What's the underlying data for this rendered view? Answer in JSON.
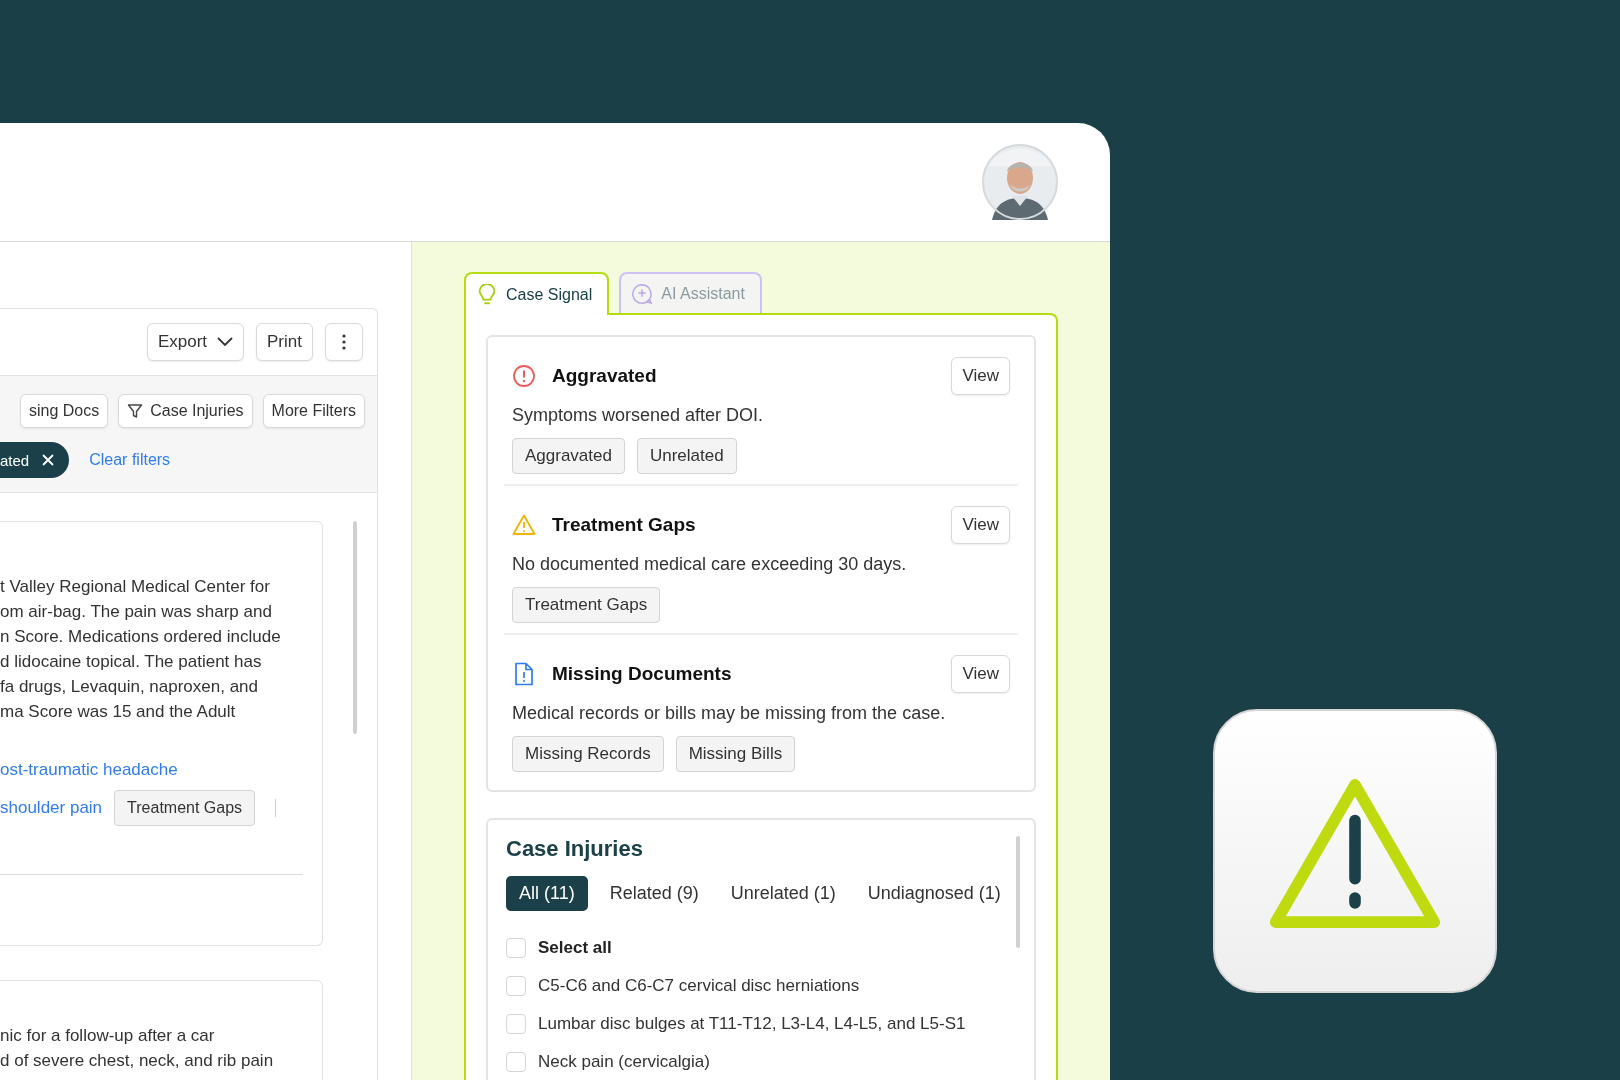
{
  "toolbar": {
    "buttons": [
      {
        "kind": "dropdown",
        "label": "Export"
      },
      {
        "kind": "plain",
        "label": "Print"
      },
      {
        "kind": "more"
      }
    ]
  },
  "filters": {
    "buttons": [
      {
        "kind": "plain",
        "label": "sing Docs"
      },
      {
        "kind": "filter",
        "label": "Case Injuries"
      },
      {
        "kind": "plain",
        "label": "More Filters"
      }
    ],
    "active": [
      {
        "label": "ated"
      }
    ],
    "clear_link": "Clear filters"
  },
  "records": [
    {
      "lines": [
        "t Valley Regional Medical Center for",
        "om air-bag. The pain was sharp and",
        "n Score. Medications ordered include",
        "d lidocaine topical. The patient has",
        "fa drugs, Levaquin, naproxen, and",
        "ma Score was 15 and the Adult"
      ],
      "link_rows": [
        {
          "links": [
            "ost-traumatic headache"
          ],
          "tags": []
        },
        {
          "links": [
            "shoulder pain"
          ],
          "tags": [
            "Treatment Gaps"
          ]
        }
      ]
    },
    {
      "lines": [
        "nic for a follow-up after a car",
        "d of severe chest, neck, and rib pain"
      ]
    }
  ],
  "tabs": [
    {
      "kind": "bulb",
      "label": "Case Signal",
      "selected": true
    },
    {
      "kind": "chat",
      "label": "AI Assistant",
      "selected": false
    }
  ],
  "signals": [
    {
      "kind": "alert",
      "title": "Aggravated",
      "action": "View",
      "description": "Symptoms worsened after DOI.",
      "tags": [
        "Aggravated",
        "Unrelated"
      ]
    },
    {
      "kind": "warning",
      "title": "Treatment Gaps",
      "action": "View",
      "description": "No documented medical care exceeding 30 days.",
      "tags": [
        "Treatment Gaps"
      ]
    },
    {
      "kind": "document",
      "title": "Missing Documents",
      "action": "View",
      "description": "Medical records or bills may be missing from the case.",
      "tags": [
        "Missing Records",
        "Missing Bills"
      ]
    }
  ],
  "injuries": {
    "title": "Case Injuries",
    "filters": [
      {
        "label": "All (11)",
        "selected": true
      },
      {
        "label": "Related (9)",
        "selected": false
      },
      {
        "label": "Unrelated (1)",
        "selected": false
      },
      {
        "label": "Undiagnosed (1)",
        "selected": false
      }
    ],
    "select_all": {
      "label": "Select all",
      "checked": false
    },
    "items": [
      {
        "label": "C5-C6 and C6-C7 cervical disc herniations",
        "checked": false
      },
      {
        "label": "Lumbar disc bulges at T11-T12, L3-L4, L4-L5, and L5-S1",
        "checked": false
      },
      {
        "label": "Neck pain (cervicalgia)",
        "checked": false
      }
    ]
  }
}
